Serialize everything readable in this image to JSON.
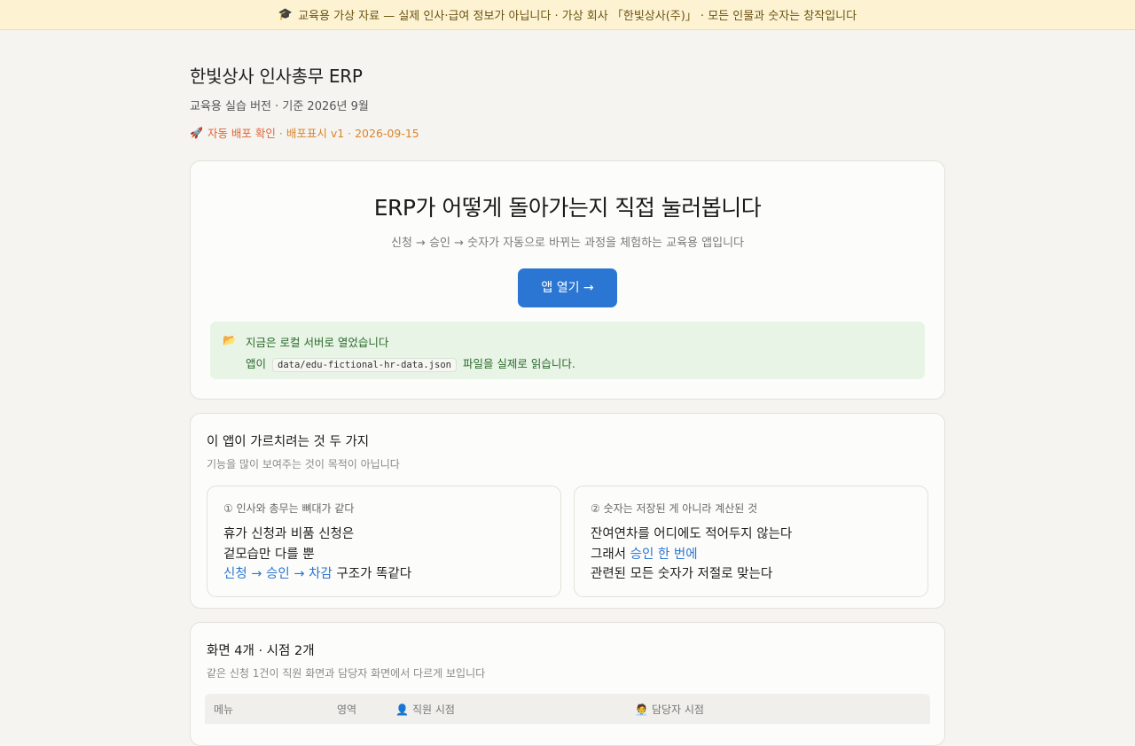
{
  "banner": {
    "icon": "graduation-cap-icon",
    "text": "교육용 가상 자료 — 실제 인사·급여 정보가 아닙니다 · 가상 회사 「한빛상사(주)」 · 모든 인물과 숫자는 창작입니다"
  },
  "header": {
    "title": "한빛상사 인사총무 ERP",
    "subtitle": "교육용 실습 버전 · 기준 2026년 9월",
    "deploy_icon": "rocket-icon",
    "deploy_label": "자동 배포 확인",
    "deploy_version": "· 배포표시 v1 · 2026-09-15"
  },
  "hero": {
    "title": "ERP가 어떻게 돌아가는지 직접 눌러봅니다",
    "tagline": "신청 → 승인 → 숫자가 자동으로 바뀌는 과정을 체험하는 교육용 앱입니다",
    "open_button": "앱 열기 →",
    "local_notice": {
      "icon": "folder-icon",
      "line1": "지금은 로컬 서버로 열었습니다",
      "line2_before": "앱이",
      "file": "data/edu-fictional-hr-data.json",
      "line2_after": "파일을 실제로 읽습니다."
    }
  },
  "lessons_section": {
    "title": "이 앱이 가르치려는 것 두 가지",
    "desc": "기능을 많이 보여주는 것이 목적이 아닙니다",
    "items": [
      {
        "head": "① 인사와 총무는 뼈대가 같다",
        "line1": "휴가 신청과 비품 신청은",
        "line2": "겉모습만 다를 뿐",
        "line3_highlight": "신청 → 승인 → 차감",
        "line3_rest": " 구조가 똑같다"
      },
      {
        "head": "② 숫자는 저장된 게 아니라 계산된 것",
        "line1": "잔여연차를 어디에도 적어두지 않는다",
        "line2_before": "그래서 ",
        "line2_highlight": "승인 한 번에",
        "line3": "관련된 모든 숫자가 저절로 맞는다"
      }
    ]
  },
  "screens_section": {
    "title": "화면 4개 · 시점 2개",
    "desc": "같은 신청 1건이 직원 화면과 담당자 화면에서 다르게 보입니다",
    "columns": {
      "menu": "메뉴",
      "area": "영역",
      "employee": "직원 시점",
      "employee_icon": "person-icon",
      "manager": "담당자 시점",
      "manager_icon": "office-worker-icon"
    }
  }
}
